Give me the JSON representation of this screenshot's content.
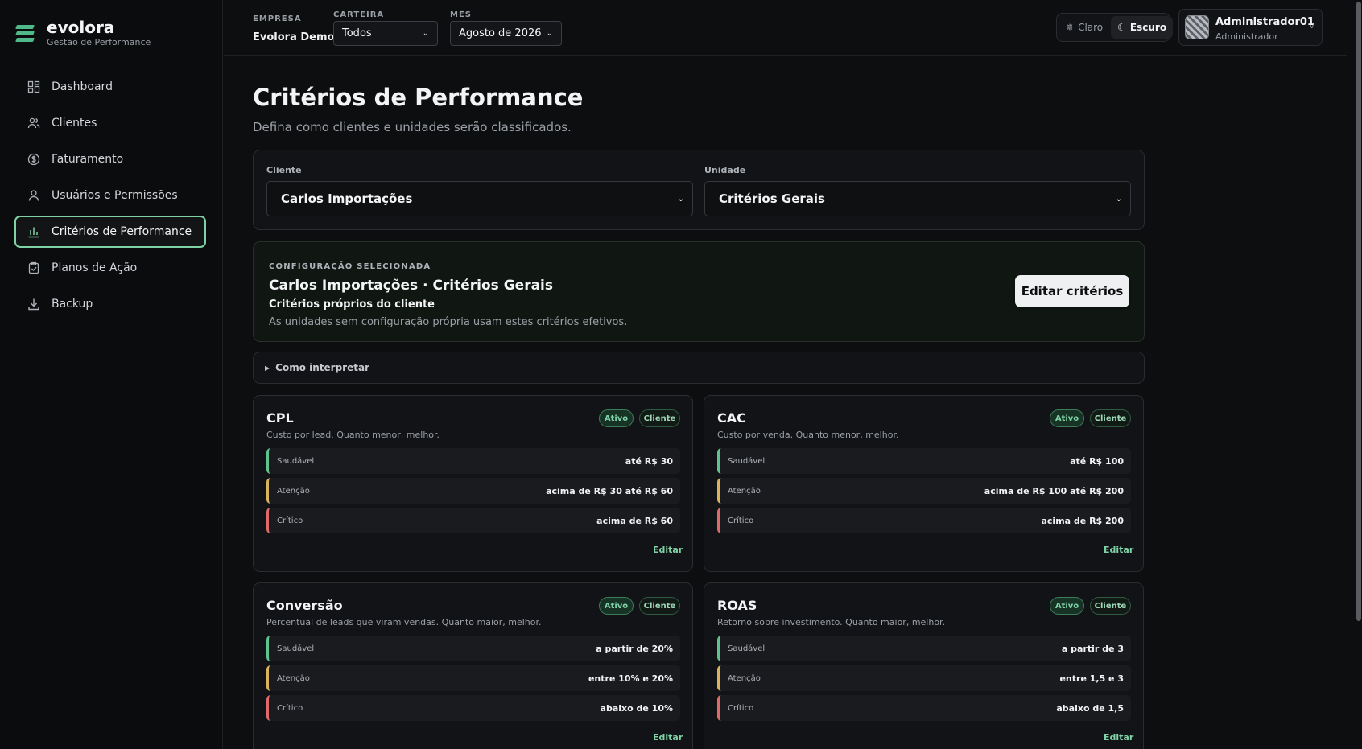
{
  "brand": {
    "name": "evolora",
    "tagline": "Gestão de Performance"
  },
  "sidebar": {
    "items": [
      {
        "label": "Dashboard",
        "icon": "dashboard-icon",
        "active": false
      },
      {
        "label": "Clientes",
        "icon": "users-icon",
        "active": false
      },
      {
        "label": "Faturamento",
        "icon": "dollar-icon",
        "active": false
      },
      {
        "label": "Usuários e Permissões",
        "icon": "user-icon",
        "active": false
      },
      {
        "label": "Critérios de Performance",
        "icon": "bar-chart-icon",
        "active": true
      },
      {
        "label": "Planos de Ação",
        "icon": "clipboard-check-icon",
        "active": false
      },
      {
        "label": "Backup",
        "icon": "download-icon",
        "active": false
      }
    ]
  },
  "topbar": {
    "empresa_label": "EMPRESA",
    "empresa_value": "Evolora Demo",
    "carteira_label": "CARTEIRA",
    "carteira_value": "Todos",
    "mes_label": "MÊS",
    "mes_value": "Agosto de 2026",
    "theme_light": "Claro",
    "theme_dark": "Escuro",
    "theme_selected": "Escuro",
    "user_name": "Administrador01",
    "user_role": "Administrador",
    "user_chevron": "v"
  },
  "page": {
    "title": "Critérios de Performance",
    "subtitle": "Defina como clientes e unidades serão classificados."
  },
  "filters": {
    "cliente_label": "Cliente",
    "cliente_value": "Carlos Importações",
    "unidade_label": "Unidade",
    "unidade_value": "Critérios Gerais"
  },
  "config": {
    "eyebrow": "CONFIGURAÇÃO SELECIONADA",
    "title": "Carlos Importações · Critérios Gerais",
    "subtitle": "Critérios próprios do cliente",
    "note": "As unidades sem configuração própria usam estes critérios efetivos.",
    "edit_label": "Editar critérios"
  },
  "interpret": {
    "label": "Como interpretar"
  },
  "cards": [
    {
      "title": "CPL",
      "desc": "Custo por lead. Quanto menor, melhor.",
      "badge_status": "Ativo",
      "badge_scope": "Cliente",
      "tiers": [
        {
          "name": "Saudável",
          "value": "até R$ 30"
        },
        {
          "name": "Atenção",
          "value": "acima de R$ 30 até R$ 60"
        },
        {
          "name": "Crítico",
          "value": "acima de R$ 60"
        }
      ],
      "edit": "Editar"
    },
    {
      "title": "CAC",
      "desc": "Custo por venda. Quanto menor, melhor.",
      "badge_status": "Ativo",
      "badge_scope": "Cliente",
      "tiers": [
        {
          "name": "Saudável",
          "value": "até R$ 100"
        },
        {
          "name": "Atenção",
          "value": "acima de R$ 100 até R$ 200"
        },
        {
          "name": "Crítico",
          "value": "acima de R$ 200"
        }
      ],
      "edit": "Editar"
    },
    {
      "title": "Conversão",
      "desc": "Percentual de leads que viram vendas. Quanto maior, melhor.",
      "badge_status": "Ativo",
      "badge_scope": "Cliente",
      "tiers": [
        {
          "name": "Saudável",
          "value": "a partir de 20%"
        },
        {
          "name": "Atenção",
          "value": "entre 10% e 20%"
        },
        {
          "name": "Crítico",
          "value": "abaixo de 10%"
        }
      ],
      "edit": "Editar"
    },
    {
      "title": "ROAS",
      "desc": "Retorno sobre investimento. Quanto maior, melhor.",
      "badge_status": "Ativo",
      "badge_scope": "Cliente",
      "tiers": [
        {
          "name": "Saudável",
          "value": "a partir de 3"
        },
        {
          "name": "Atenção",
          "value": "entre 1,5 e 3"
        },
        {
          "name": "Crítico",
          "value": "abaixo de 1,5"
        }
      ],
      "edit": "Editar"
    }
  ],
  "colors": {
    "accent": "#7fd1a6",
    "healthy": "#5fc28f",
    "attention": "#d9b45a",
    "critical": "#e06a6a",
    "background": "#0d0e10"
  }
}
